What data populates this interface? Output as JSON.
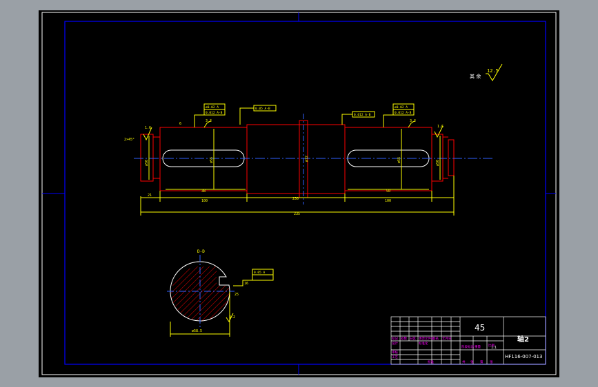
{
  "drawing": {
    "material": "45",
    "part_name": "轴2",
    "drawing_number": "HF116-007-013",
    "scale": "1:1"
  },
  "annotations": {
    "surface_finish_note": "其 余",
    "surface_finish_value": "12.5",
    "section_label": "D-D",
    "dims": {
      "overall_length": "235",
      "seg_left_shoulder": "21",
      "seg_left_keyseat": "100",
      "seg_middle": "250",
      "seg_right_keyseat": "100",
      "key_left_offset": "6",
      "key_left_len": "38",
      "key_right_len": "50",
      "dia_right_end": "ø50",
      "dia_left_end": "ø50",
      "dia_mid": "ø72",
      "dia_journal": "ø55",
      "chamfer": "2×45°",
      "section_dia": "ø58.5",
      "section_depth": "25",
      "section_width": "16"
    },
    "roughness_marks": [
      "1.6",
      "3.2",
      "3.2",
      "1.6",
      "3.2"
    ],
    "tolerance_frames": [
      "ø0.02 A",
      "0.012 A-B",
      "0.05 A-B",
      "0.012 A-B",
      "ø0.02 A",
      "0.012 A-B",
      "0.05 A"
    ]
  },
  "title_block": {
    "material_cell": "45",
    "name_cell": "轴2",
    "number_cell": "HF116-007-013",
    "mag_labels": [
      "标记",
      "处数",
      "分区",
      "更改文件号",
      "签名",
      "年月日",
      "阶段标记",
      "重量",
      "比例",
      "设计",
      "标准化",
      "审核",
      "工艺",
      "批准",
      "共",
      "张",
      "第",
      "张"
    ]
  },
  "colors": {
    "frame_blue": "#0000ff",
    "outline_red": "#ff0000",
    "dim_yellow": "#ffff00",
    "center_blue": "#3060ff",
    "white_line": "#ffffff",
    "magenta_text": "#ff00ff"
  }
}
